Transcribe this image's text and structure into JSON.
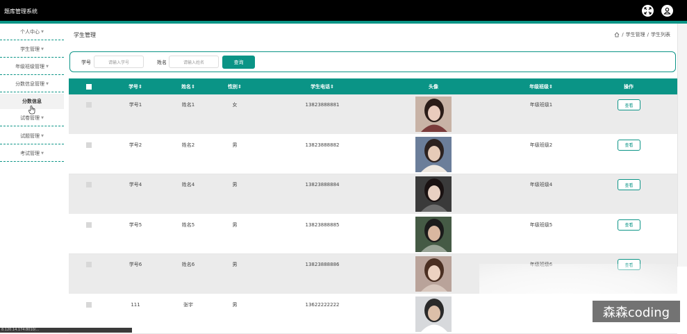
{
  "app": {
    "title": "题库管理系统"
  },
  "sidebar": {
    "items": [
      {
        "label": "个人中心"
      },
      {
        "label": "学生管理"
      },
      {
        "label": "年级班级管理"
      },
      {
        "label": "分数信息管理"
      },
      {
        "label": "分数信息"
      },
      {
        "label": "试卷管理"
      },
      {
        "label": "试题管理"
      },
      {
        "label": "考试管理"
      }
    ]
  },
  "page": {
    "title": "学生管理",
    "breadcrumb": [
      "学生管理",
      "学生列表"
    ]
  },
  "search": {
    "student_no_label": "学号",
    "student_no_placeholder": "请输入学号",
    "name_label": "姓名",
    "name_placeholder": "请输入姓名",
    "button": "查询"
  },
  "table": {
    "headers": [
      "学号",
      "姓名",
      "性别",
      "学生电话",
      "头像",
      "年级班级",
      "操作"
    ],
    "rows": [
      {
        "no": "学号1",
        "name": "姓名1",
        "gender": "女",
        "phone": "13823888881",
        "class": "年级班级1",
        "action": "查看"
      },
      {
        "no": "学号2",
        "name": "姓名2",
        "gender": "男",
        "phone": "13823888882",
        "class": "年级班级2",
        "action": "查看"
      },
      {
        "no": "学号4",
        "name": "姓名4",
        "gender": "男",
        "phone": "13823888884",
        "class": "年级班级4",
        "action": "查看"
      },
      {
        "no": "学号5",
        "name": "姓名5",
        "gender": "男",
        "phone": "13823888885",
        "class": "年级班级5",
        "action": "查看"
      },
      {
        "no": "学号6",
        "name": "姓名6",
        "gender": "男",
        "phone": "13823888886",
        "class": "年级班级6",
        "action": "查看"
      },
      {
        "no": "111",
        "name": "张宇",
        "gender": "男",
        "phone": "13622222222",
        "class": "",
        "action": ""
      }
    ]
  },
  "status_bar": {
    "text": "8.120.14.174:8010/..."
  },
  "watermark": {
    "text": "森森coding"
  },
  "colors": {
    "accent": "#0a9486",
    "topbar": "#000000"
  }
}
